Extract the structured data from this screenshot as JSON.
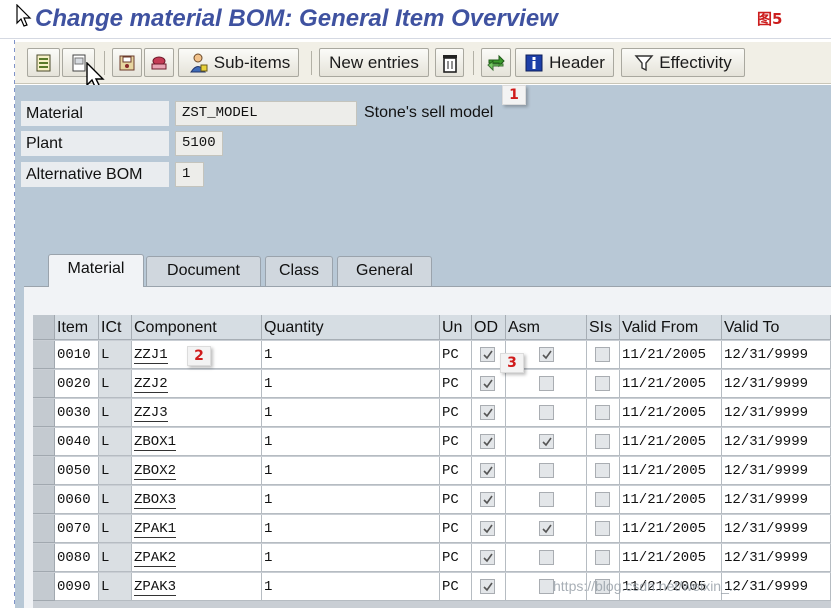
{
  "window": {
    "title": "Change material BOM: General Item Overview",
    "figure_label": "图5"
  },
  "toolbar": {
    "sub_items_label": "Sub-items",
    "new_entries_label": "New entries",
    "header_label": "Header",
    "effectivity_label": "Effectivity"
  },
  "header_fields": {
    "material_label": "Material",
    "material_value": "ZST_MODEL",
    "material_desc": "Stone's sell model",
    "plant_label": "Plant",
    "plant_value": "5100",
    "alt_bom_label": "Alternative BOM",
    "alt_bom_value": "1"
  },
  "tabs": [
    {
      "label": "Material",
      "active": true
    },
    {
      "label": "Document",
      "active": false
    },
    {
      "label": "Class",
      "active": false
    },
    {
      "label": "General",
      "active": false
    }
  ],
  "table": {
    "columns": [
      "Item",
      "ICt",
      "Component",
      "Quantity",
      "Un",
      "OD",
      "Asm",
      "SIs",
      "Valid From",
      "Valid To"
    ],
    "rows": [
      {
        "item": "0010",
        "ict": "L",
        "component": "ZZJ1",
        "quantity": "1",
        "un": "PC",
        "od": true,
        "asm": true,
        "sis": false,
        "valid_from": "11/21/2005",
        "valid_to": "12/31/9999"
      },
      {
        "item": "0020",
        "ict": "L",
        "component": "ZZJ2",
        "quantity": "1",
        "un": "PC",
        "od": true,
        "asm": false,
        "sis": false,
        "valid_from": "11/21/2005",
        "valid_to": "12/31/9999"
      },
      {
        "item": "0030",
        "ict": "L",
        "component": "ZZJ3",
        "quantity": "1",
        "un": "PC",
        "od": true,
        "asm": false,
        "sis": false,
        "valid_from": "11/21/2005",
        "valid_to": "12/31/9999"
      },
      {
        "item": "0040",
        "ict": "L",
        "component": "ZBOX1",
        "quantity": "1",
        "un": "PC",
        "od": true,
        "asm": true,
        "sis": false,
        "valid_from": "11/21/2005",
        "valid_to": "12/31/9999"
      },
      {
        "item": "0050",
        "ict": "L",
        "component": "ZBOX2",
        "quantity": "1",
        "un": "PC",
        "od": true,
        "asm": false,
        "sis": false,
        "valid_from": "11/21/2005",
        "valid_to": "12/31/9999"
      },
      {
        "item": "0060",
        "ict": "L",
        "component": "ZBOX3",
        "quantity": "1",
        "un": "PC",
        "od": true,
        "asm": false,
        "sis": false,
        "valid_from": "11/21/2005",
        "valid_to": "12/31/9999"
      },
      {
        "item": "0070",
        "ict": "L",
        "component": "ZPAK1",
        "quantity": "1",
        "un": "PC",
        "od": true,
        "asm": true,
        "sis": false,
        "valid_from": "11/21/2005",
        "valid_to": "12/31/9999"
      },
      {
        "item": "0080",
        "ict": "L",
        "component": "ZPAK2",
        "quantity": "1",
        "un": "PC",
        "od": true,
        "asm": false,
        "sis": false,
        "valid_from": "11/21/2005",
        "valid_to": "12/31/9999"
      },
      {
        "item": "0090",
        "ict": "L",
        "component": "ZPAK3",
        "quantity": "1",
        "un": "PC",
        "od": true,
        "asm": false,
        "sis": false,
        "valid_from": "11/21/2005",
        "valid_to": "12/31/9999"
      }
    ]
  },
  "annotations": {
    "marker_1": "1",
    "marker_2": "2",
    "marker_3": "3"
  },
  "watermark": "https://blog.csdn.net/weixin_..."
}
